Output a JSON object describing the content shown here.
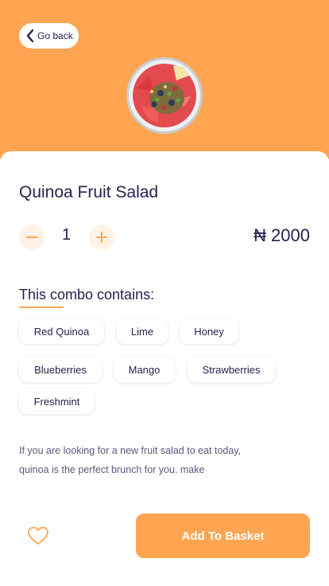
{
  "header": {
    "back_label": "Go back",
    "background_color": "#FFA451"
  },
  "product": {
    "name": "Quinoa Fruit Salad",
    "quantity": "1",
    "currency_symbol": "₦",
    "price": "2000",
    "image_icon": "fruit-salad-bowl"
  },
  "combo": {
    "title": "This combo contains:",
    "items": [
      "Red Quinoa",
      "Lime",
      "Honey",
      "Blueberries",
      "Mango",
      "Strawberries",
      "Freshmint"
    ]
  },
  "description": {
    "line1": "If you are looking for a new fruit salad to eat today,",
    "line2": "quinoa is the perfect brunch for you. make"
  },
  "actions": {
    "add_to_basket_label": "Add To Basket",
    "favorite_icon": "heart-outline"
  },
  "colors": {
    "accent": "#FFA451",
    "text": "#27214D",
    "accent_light": "#FFF2E7"
  }
}
